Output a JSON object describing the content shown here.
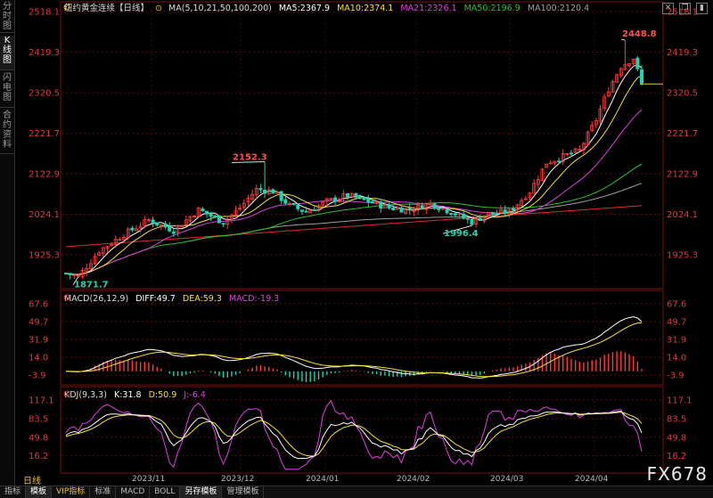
{
  "sidebar": {
    "tabs": [
      "分时图",
      "K线图",
      "闪电图",
      "合约资料"
    ],
    "active": 1
  },
  "main_header": {
    "title": "纽约黄金连续【日线】",
    "ma_params": "MA(5,10,21,50,100,200)",
    "ma5": "MA5:2367.9",
    "ma10": "MA10:2374.1",
    "ma21": "MA21:2326.1",
    "ma50": "MA50:2196.9",
    "ma100": "MA100:2120.4"
  },
  "macd_header": {
    "params": "MACD(26,12,9)",
    "diff": "DIFF:49.7",
    "dea": "DEA:59.3",
    "macd": "MACD:-19.3"
  },
  "kdj_header": {
    "params": "KDJ(9,3,3)",
    "k": "K:31.8",
    "d": "D:50.9",
    "j": "J:-6.4"
  },
  "period_label": "日线",
  "watermark": "FX678",
  "bottom_tabs": [
    "指标",
    "模板",
    "VIP指标",
    "标准",
    "MACD",
    "BOLL",
    "另存模板",
    "管理模板"
  ],
  "colors": {
    "up": "#ff3b3b",
    "down": "#21d4b0",
    "ma5": "#ffffff",
    "ma10": "#f5e13c",
    "ma21": "#e040e0",
    "ma50": "#29c229",
    "ma100": "#a0a0a0",
    "ma200": "#e02a2a"
  },
  "chart_data": [
    {
      "type": "candlestick",
      "name": "price",
      "x_labels": [
        "2023/11",
        "2023/12",
        "2024/01",
        "2024/02",
        "2024/03",
        "2024/04"
      ],
      "y_ticks": [
        "2518.1",
        "2419.3",
        "2320.5",
        "2221.7",
        "2122.9",
        "2024.1",
        "1925.3"
      ],
      "ylim": [
        1860,
        2525
      ],
      "annotations": [
        {
          "label": "2448.8",
          "note": "high",
          "value": 2448.8
        },
        {
          "label": "2152.3",
          "note": "high",
          "value": 2152.3
        },
        {
          "label": "1871.7",
          "note": "low",
          "value": 1871.7
        },
        {
          "label": "1996.4",
          "note": "low",
          "value": 1996.4
        }
      ],
      "ma_last": {
        "MA5": 2367.9,
        "MA10": 2374.1,
        "MA21": 2326.1,
        "MA50": 2196.9,
        "MA100": 2120.4
      },
      "last_close": 2342
    },
    {
      "type": "bar",
      "name": "MACD",
      "y_ticks": [
        "67.6",
        "49.7",
        "31.9",
        "14.0",
        "-3.9"
      ],
      "ylim": [
        -10,
        72
      ],
      "series": [
        {
          "name": "DIFF",
          "last": 49.7
        },
        {
          "name": "DEA",
          "last": 59.3
        },
        {
          "name": "MACD",
          "last": -19.3
        }
      ]
    },
    {
      "type": "line",
      "name": "KDJ",
      "y_ticks": [
        "117.1",
        "83.5",
        "49.8",
        "16.2"
      ],
      "ylim": [
        -10,
        125
      ],
      "series": [
        {
          "name": "K",
          "last": 31.8
        },
        {
          "name": "D",
          "last": 50.9
        },
        {
          "name": "J",
          "last": -6.4
        }
      ]
    }
  ]
}
